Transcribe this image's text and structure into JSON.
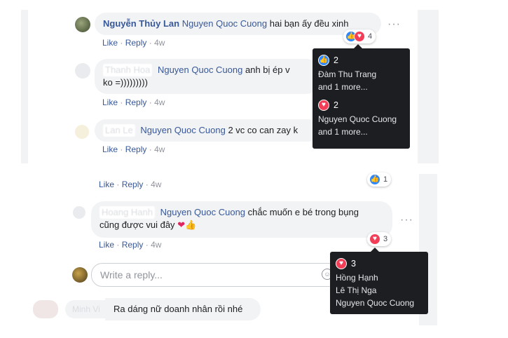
{
  "comments": [
    {
      "author": "Nguyễn Thủy Lan",
      "tag": "Nguyen Quoc Cuong",
      "text": "hai bạn ấy đều xinh",
      "like": "Like",
      "reply": "Reply",
      "time": "4w",
      "reaction_count": "4"
    },
    {
      "author": "",
      "tag": "Nguyen Quoc Cuong",
      "text_line1": "anh bị ép v",
      "text_line2": "ko =)))))))))",
      "like": "Like",
      "reply": "Reply",
      "time": "4w"
    },
    {
      "author": "",
      "tag": "Nguyen Quoc Cuong",
      "text": "2 vc co can zay k",
      "like": "Like",
      "reply": "Reply",
      "time": "4w"
    },
    {
      "like": "Like",
      "reply": "Reply",
      "time": "4w",
      "reaction_count": "1"
    },
    {
      "author": "",
      "tag": "Nguyen Quoc Cuong",
      "text_line1": "chắc muốn e bé trong bụng",
      "text_line2": "cũng được vui đây",
      "like": "Like",
      "reply": "Reply",
      "time": "4w",
      "reaction_count": "3"
    },
    {
      "author": "",
      "text": "Ra dáng nữ doanh nhân rồi nhé"
    }
  ],
  "reply_input": {
    "placeholder": "Write a reply..."
  },
  "tooltip1": {
    "like_count": "2",
    "like_names": [
      "Đàm Thu Trang",
      "and 1 more..."
    ],
    "love_count": "2",
    "love_names": [
      "Nguyen Quoc Cuong",
      "and 1 more..."
    ]
  },
  "tooltip2": {
    "love_count": "3",
    "names": [
      "Hồng Hạnh",
      "Lê Thị Nga",
      "Nguyen Quoc Cuong"
    ]
  },
  "icons": {
    "like": "thumbs-up-icon",
    "love": "heart-icon",
    "more": "more-options-icon",
    "emoji": "emoji-icon"
  },
  "colors": {
    "link": "#385898",
    "like": "#2d88ff",
    "love": "#f33e58",
    "tooltip_bg": "#1c1e21",
    "bubble": "#f2f3f5"
  }
}
